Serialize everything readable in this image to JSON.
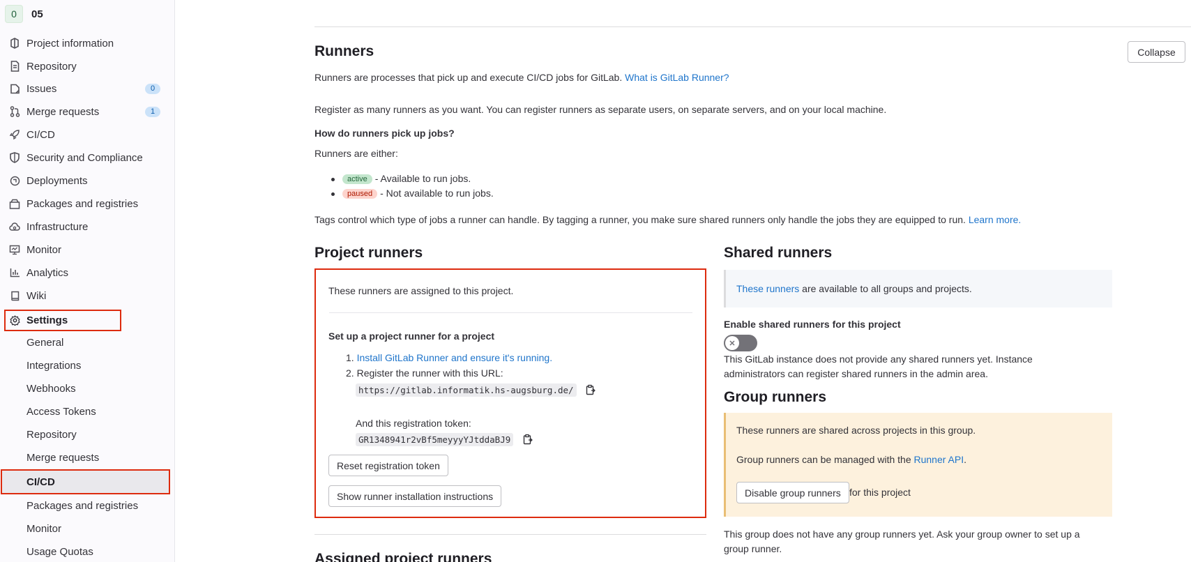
{
  "project": {
    "avatar_letter": "0",
    "name": "05"
  },
  "sidebar": {
    "items": [
      {
        "label": "Project information",
        "icon": "project-icon"
      },
      {
        "label": "Repository",
        "icon": "document-icon"
      },
      {
        "label": "Issues",
        "icon": "issues-icon",
        "badge": "0"
      },
      {
        "label": "Merge requests",
        "icon": "merge-request-icon",
        "badge": "1"
      },
      {
        "label": "CI/CD",
        "icon": "rocket-icon"
      },
      {
        "label": "Security and Compliance",
        "icon": "shield-icon"
      },
      {
        "label": "Deployments",
        "icon": "deployments-icon"
      },
      {
        "label": "Packages and registries",
        "icon": "package-icon"
      },
      {
        "label": "Infrastructure",
        "icon": "cloud-gear-icon"
      },
      {
        "label": "Monitor",
        "icon": "monitor-icon"
      },
      {
        "label": "Analytics",
        "icon": "chart-icon"
      },
      {
        "label": "Wiki",
        "icon": "book-icon"
      },
      {
        "label": "Settings",
        "icon": "gear-icon"
      }
    ],
    "settings_sub": [
      "General",
      "Integrations",
      "Webhooks",
      "Access Tokens",
      "Repository",
      "Merge requests",
      "CI/CD",
      "Packages and registries",
      "Monitor",
      "Usage Quotas"
    ]
  },
  "runners": {
    "title": "Runners",
    "collapse": "Collapse",
    "intro": "Runners are processes that pick up and execute CI/CD jobs for GitLab.",
    "intro_link": "What is GitLab Runner?",
    "register_text": "Register as many runners as you want. You can register runners as separate users, on separate servers, and on your local machine.",
    "how_title": "How do runners pick up jobs?",
    "either": "Runners are either:",
    "active_pill": "active",
    "active_text": "- Available to run jobs.",
    "paused_pill": "paused",
    "paused_text": "- Not available to run jobs.",
    "tags_text": "Tags control which type of jobs a runner can handle. By tagging a runner, you make sure shared runners only handle the jobs they are equipped to run.",
    "learn_more": "Learn more."
  },
  "project_runners": {
    "title": "Project runners",
    "assigned_text": "These runners are assigned to this project.",
    "setup_title": "Set up a project runner for a project",
    "step1_num": "1.",
    "step1_link": "Install GitLab Runner and ensure it's running.",
    "step2_num": "2.",
    "step2_text": "Register the runner with this URL:",
    "url": "https://gitlab.informatik.hs-augsburg.de/",
    "token_label": "And this registration token:",
    "token": "GR1348941r2vBf5meyyyYJtddaBJ9",
    "reset_btn": "Reset registration token",
    "show_btn": "Show runner installation instructions",
    "assigned_title": "Assigned project runners"
  },
  "shared_runners": {
    "title": "Shared runners",
    "info_link": "These runners",
    "info_text": "are available to all groups and projects.",
    "enable_label": "Enable shared runners for this project",
    "note_line1": "This GitLab instance does not provide any shared runners yet. Instance",
    "note_line2": "administrators can register shared runners in the admin area."
  },
  "group_runners": {
    "title": "Group runners",
    "shared_text": "These runners are shared across projects in this group.",
    "managed_text": "Group runners can be managed with the",
    "api_link": "Runner API",
    "api_period": ".",
    "disable_btn": "Disable group runners",
    "for_project": "for this project",
    "none_line1": "This group does not have any group runners yet. Ask your group owner to set up a",
    "none_line2": "group runner."
  },
  "colors": {
    "accent": "#1f75cb",
    "highlight": "#dd2b0e"
  }
}
